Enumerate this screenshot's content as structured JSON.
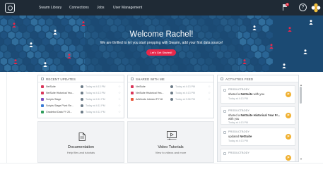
{
  "nav": {
    "items": [
      "Swarm Library",
      "Connections",
      "Jobs",
      "User Management"
    ],
    "notifications": "6"
  },
  "hero": {
    "title": "Welcome Rachel!",
    "subtitle": "We are thrilled to let you start prepping with Swarm, add your first data source!",
    "button": "Let's Get Started!"
  },
  "recent": {
    "title": "RECENT UPDATES",
    "rows": [
      {
        "name": "NetSuite",
        "time": "Today at 4:13 PM",
        "color": "#d9365a"
      },
      {
        "name": "NetSuite Historical Yea...",
        "time": "Today at 4:13 PM",
        "color": "#d9365a"
      },
      {
        "name": "Scripts Stage",
        "time": "Today at 4:11 PM",
        "color": "#7a4fbf"
      },
      {
        "name": "Scripts Stage Pivot Re...",
        "time": "Today at 4:11 PM",
        "color": "#3a7bd5"
      },
      {
        "name": "Gradebot Data FY 20...",
        "time": "Today at 4:11 PM",
        "color": "#2e9c5a"
      }
    ]
  },
  "shared": {
    "title": "SHARED WITH ME",
    "rows": [
      {
        "name": "NetSuite",
        "time": "Today at 4:13 PM",
        "color": "#d9365a"
      },
      {
        "name": "NetSuite Historical Yea...",
        "time": "Today at 4:13 PM",
        "color": "#d9365a"
      },
      {
        "name": "AdWords Interest FY'18",
        "time": "Today at 3:38 PM",
        "color": "#e8553a"
      }
    ]
  },
  "tiles": {
    "documentation": {
      "title": "Documentation",
      "subtitle": "Help files and tutorials"
    },
    "videos": {
      "title": "Video Tutorials",
      "subtitle": "View to videos and more"
    }
  },
  "feed": {
    "title": "ACTIVITIES FEED",
    "items": [
      {
        "user": "PRODUCTBODY",
        "pre": "shared a ",
        "bold": "NetSuite",
        "post": " with you",
        "time": "Today at 4:13 PM",
        "badge": "P"
      },
      {
        "user": "PRODUCTBODY",
        "pre": "shared a ",
        "bold": "NetSuite Historical Year Fr...",
        "post": " with you",
        "time": "Today at 4:13 PM",
        "badge": "P"
      },
      {
        "user": "PRODUCTBODY",
        "pre": "updated ",
        "bold": "NetSuite",
        "post": "",
        "time": "Today at 4:13 PM",
        "badge": "P"
      },
      {
        "user": "PRODUCTBODY",
        "pre": "",
        "bold": "",
        "post": "",
        "time": "",
        "badge": "P"
      }
    ]
  },
  "colors": {
    "topbar": "#1f2a35",
    "hero": "#1b4a73",
    "accent": "#e8284b",
    "badge": "#f0b030"
  }
}
